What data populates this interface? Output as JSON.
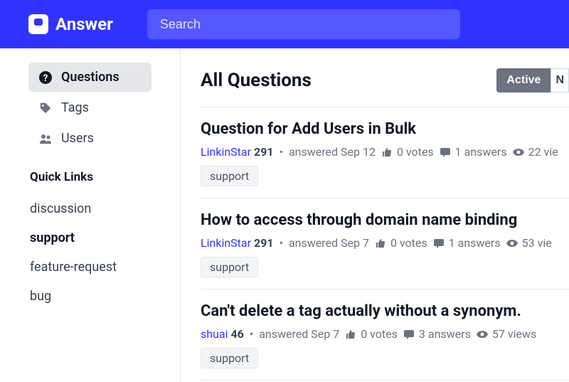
{
  "header": {
    "brand": "Answer",
    "search_placeholder": "Search"
  },
  "sidebar": {
    "nav": [
      {
        "label": "Questions",
        "icon": "question-circle-icon",
        "active": true
      },
      {
        "label": "Tags",
        "icon": "tag-icon",
        "active": false
      },
      {
        "label": "Users",
        "icon": "users-icon",
        "active": false
      }
    ],
    "quick_links_title": "Quick Links",
    "quick_links": [
      {
        "label": "discussion",
        "active": false
      },
      {
        "label": "support",
        "active": true
      },
      {
        "label": "feature-request",
        "active": false
      },
      {
        "label": "bug",
        "active": false
      }
    ]
  },
  "main": {
    "title": "All Questions",
    "filters": [
      "Active",
      "N"
    ],
    "questions": [
      {
        "title": "Question for Add Users in Bulk",
        "user": "LinkinStar",
        "reputation": "291",
        "action": "answered Sep 12",
        "votes": "0 votes",
        "answers": "1 answers",
        "views": "22 vie",
        "tags": [
          "support"
        ]
      },
      {
        "title": "How to access through domain name binding",
        "user": "LinkinStar",
        "reputation": "291",
        "action": "answered Sep 7",
        "votes": "0 votes",
        "answers": "1 answers",
        "views": "53 vie",
        "tags": [
          "support"
        ]
      },
      {
        "title": "Can't delete a tag actually without a synonym.",
        "user": "shuai",
        "reputation": "46",
        "action": "answered Sep 7",
        "votes": "0 votes",
        "answers": "3 answers",
        "views": "57 views",
        "tags": [
          "support"
        ]
      }
    ]
  }
}
